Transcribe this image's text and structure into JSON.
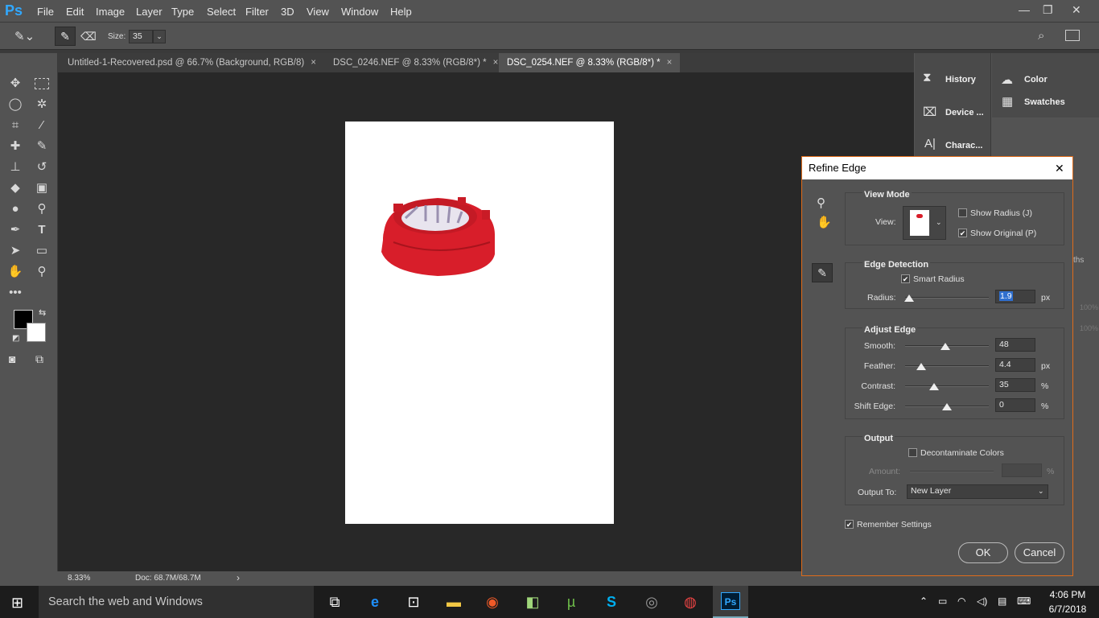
{
  "app": {
    "logo": "Ps",
    "colors": {
      "accent": "#31a8ff",
      "dialog_border": "#e06c1a"
    }
  },
  "menu": [
    "File",
    "Edit",
    "Image",
    "Layer",
    "Type",
    "Select",
    "Filter",
    "3D",
    "View",
    "Window",
    "Help"
  ],
  "options_bar": {
    "size_label": "Size:",
    "size_value": "35"
  },
  "tabs": [
    {
      "label": "Untitled-1-Recovered.psd @ 66.7% (Background, RGB/8)",
      "close": "×"
    },
    {
      "label": "DSC_0246.NEF @ 8.33% (RGB/8*) *",
      "close": "×"
    },
    {
      "label": "DSC_0254.NEF @ 8.33% (RGB/8*) *",
      "close": "×",
      "active": true
    }
  ],
  "status": {
    "zoom": "8.33%",
    "doc": "Doc: 68.7M/68.7M",
    "arrow": "›"
  },
  "panels": {
    "left_col": [
      "History",
      "Device ...",
      "Charac..."
    ],
    "right_col": [
      "Color",
      "Swatches"
    ],
    "partial_tab": "ths",
    "partial_vals": [
      "100%",
      "100%"
    ]
  },
  "dialog": {
    "title": "Refine Edge",
    "close": "✕",
    "view_mode": {
      "header": "View Mode",
      "view_label": "View:",
      "show_radius": "Show Radius (J)",
      "show_original": "Show Original (P)",
      "show_radius_checked": false,
      "show_original_checked": true
    },
    "edge_detection": {
      "header": "Edge Detection",
      "smart_radius": "Smart Radius",
      "smart_radius_checked": true,
      "radius_label": "Radius:",
      "radius_value": "1.9",
      "radius_unit": "px",
      "radius_level": 0.05
    },
    "adjust_edge": {
      "header": "Adjust Edge",
      "rows": [
        {
          "label": "Smooth:",
          "value": "48",
          "unit": "",
          "level": 0.48
        },
        {
          "label": "Feather:",
          "value": "4.4",
          "unit": "px",
          "level": 0.19
        },
        {
          "label": "Contrast:",
          "value": "35",
          "unit": "%",
          "level": 0.35
        },
        {
          "label": "Shift Edge:",
          "value": "0",
          "unit": "%",
          "level": 0.5
        }
      ]
    },
    "output": {
      "header": "Output",
      "decontaminate": "Decontaminate Colors",
      "decontaminate_checked": false,
      "amount_label": "Amount:",
      "amount_unit": "%",
      "output_to_label": "Output To:",
      "output_to_value": "New Layer"
    },
    "remember": "Remember Settings",
    "remember_checked": true,
    "ok": "OK",
    "cancel": "Cancel"
  },
  "taskbar": {
    "search_placeholder": "Search the web and Windows",
    "time": "4:06 PM",
    "date": "6/7/2018"
  }
}
